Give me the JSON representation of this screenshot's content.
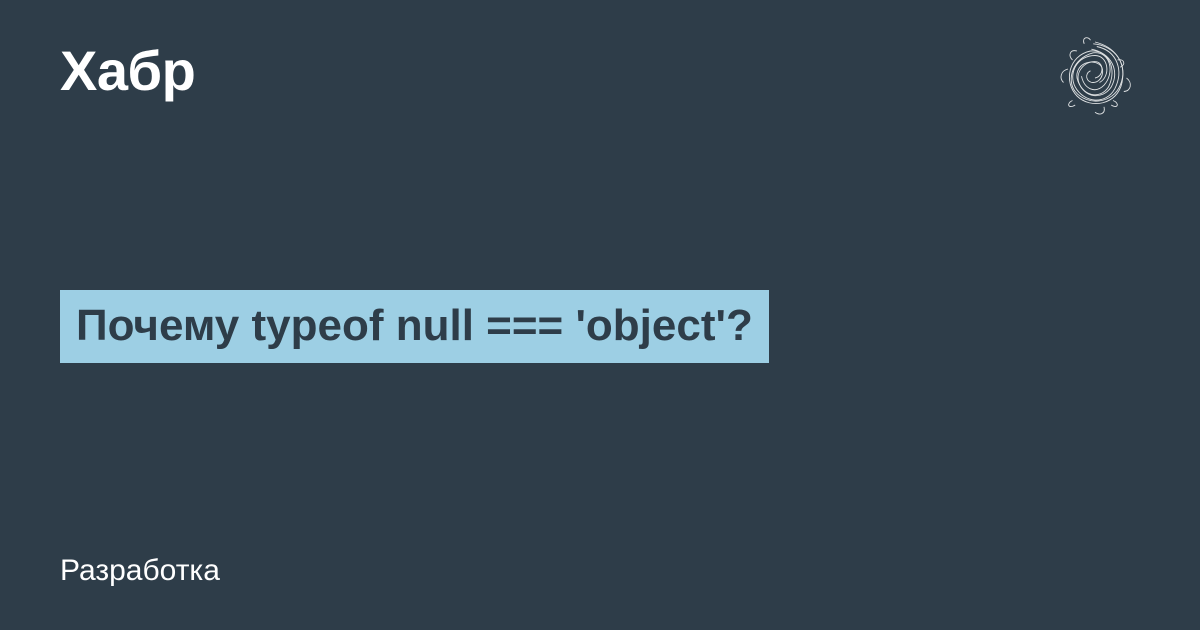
{
  "header": {
    "brand": "Хабр"
  },
  "article": {
    "title": "Почему typeof null === 'object'?"
  },
  "footer": {
    "category": "Разработка"
  }
}
